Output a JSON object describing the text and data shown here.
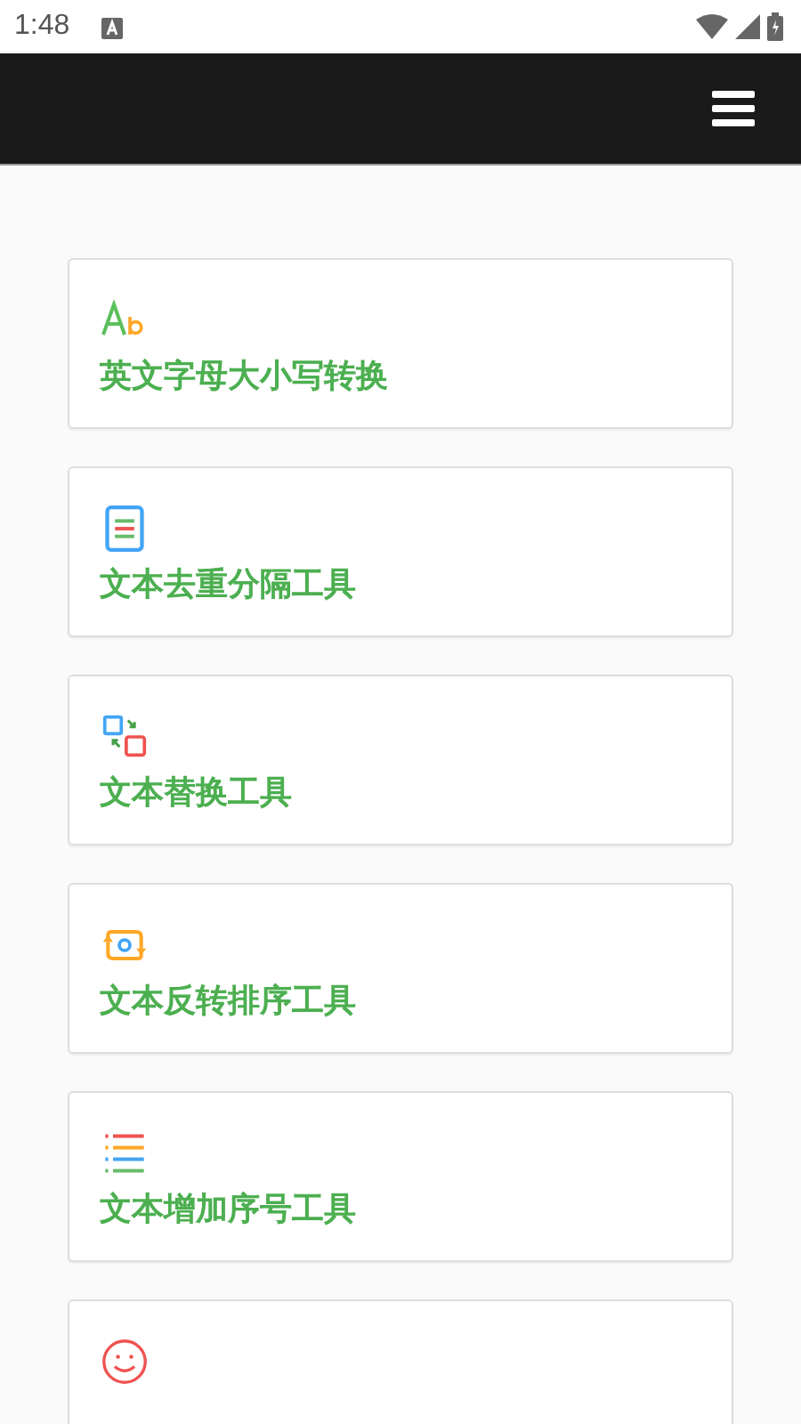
{
  "status_bar": {
    "time": "1:48"
  },
  "tools": [
    {
      "kind": "case",
      "label": "英文字母大小写转换"
    },
    {
      "kind": "document",
      "label": "文本去重分隔工具"
    },
    {
      "kind": "swap",
      "label": "文本替换工具"
    },
    {
      "kind": "rotate",
      "label": "文本反转排序工具"
    },
    {
      "kind": "list",
      "label": "文本增加序号工具"
    },
    {
      "kind": "smiley"
    }
  ]
}
